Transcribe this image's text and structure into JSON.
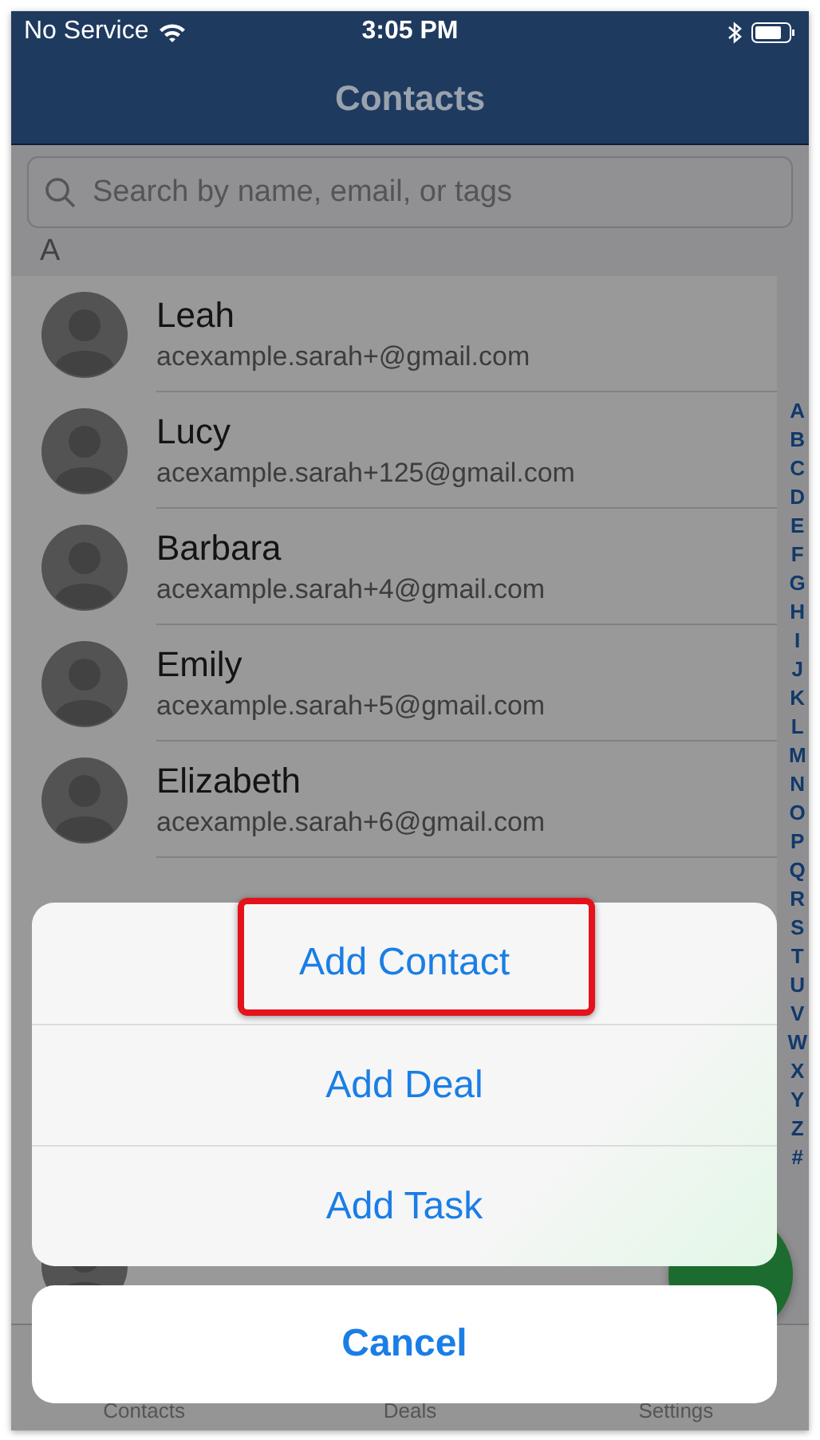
{
  "status_bar": {
    "carrier": "No Service",
    "time": "3:05 PM"
  },
  "nav_bar": {
    "title": "Contacts"
  },
  "search": {
    "placeholder": "Search by name, email, or tags"
  },
  "section": {
    "header": "A"
  },
  "contacts": [
    {
      "name": "Leah",
      "email": "acexample.sarah+@gmail.com"
    },
    {
      "name": "Lucy",
      "email": "acexample.sarah+125@gmail.com"
    },
    {
      "name": "Barbara",
      "email": "acexample.sarah+4@gmail.com"
    },
    {
      "name": "Emily",
      "email": "acexample.sarah+5@gmail.com"
    },
    {
      "name": "Elizabeth",
      "email": "acexample.sarah+6@gmail.com"
    }
  ],
  "index_letters": [
    "A",
    "B",
    "C",
    "D",
    "E",
    "F",
    "G",
    "H",
    "I",
    "J",
    "K",
    "L",
    "M",
    "N",
    "O",
    "P",
    "Q",
    "R",
    "S",
    "T",
    "U",
    "V",
    "W",
    "X",
    "Y",
    "Z",
    "#"
  ],
  "tab_bar": [
    {
      "label": "Contacts"
    },
    {
      "label": "Deals"
    },
    {
      "label": "Settings"
    }
  ],
  "action_sheet": {
    "actions": [
      {
        "label": "Add Contact",
        "highlighted": true
      },
      {
        "label": "Add Deal",
        "highlighted": false
      },
      {
        "label": "Add Task",
        "highlighted": false
      }
    ],
    "cancel": "Cancel"
  }
}
